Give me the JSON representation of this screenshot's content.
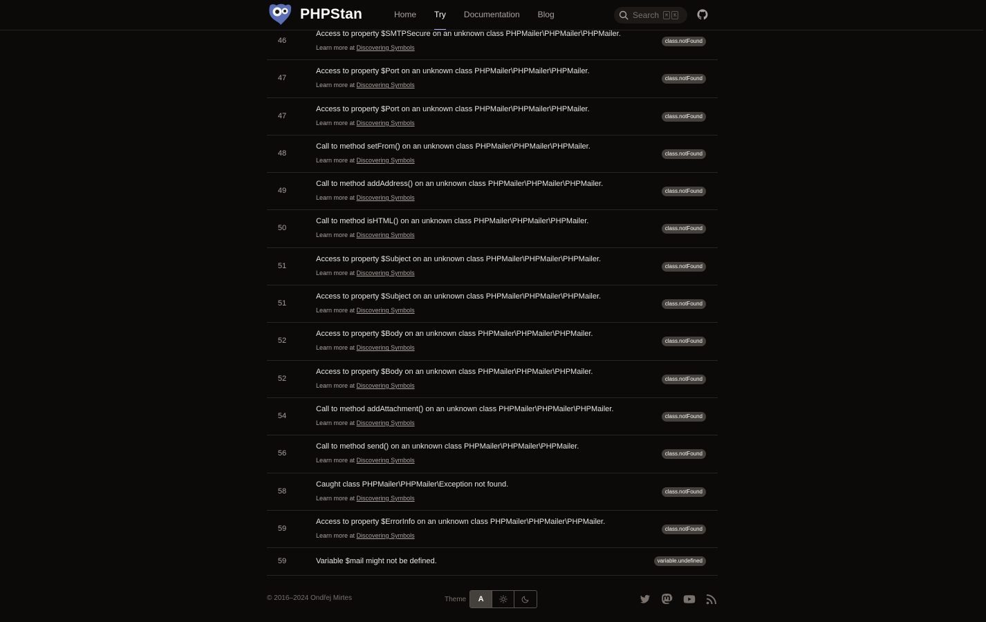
{
  "header": {
    "brand": "PHPStan",
    "nav": [
      {
        "label": "Home",
        "active": false
      },
      {
        "label": "Try",
        "active": true
      },
      {
        "label": "Documentation",
        "active": false
      },
      {
        "label": "Blog",
        "active": false
      }
    ],
    "search_label": "Search",
    "search_kbd": [
      "⌘",
      "K"
    ]
  },
  "errors": [
    {
      "line": "46",
      "message": "Access to property $SMTPSecure on an unknown class PHPMailer\\PHPMailer\\PHPMailer.",
      "learn_prefix": "Learn more at",
      "learn_link": "Discovering Symbols",
      "identifier": "class.notFound"
    },
    {
      "line": "47",
      "message": "Access to property $Port on an unknown class PHPMailer\\PHPMailer\\PHPMailer.",
      "learn_prefix": "Learn more at",
      "learn_link": "Discovering Symbols",
      "identifier": "class.notFound"
    },
    {
      "line": "47",
      "message": "Access to property $Port on an unknown class PHPMailer\\PHPMailer\\PHPMailer.",
      "learn_prefix": "Learn more at",
      "learn_link": "Discovering Symbols",
      "identifier": "class.notFound"
    },
    {
      "line": "48",
      "message": "Call to method setFrom() on an unknown class PHPMailer\\PHPMailer\\PHPMailer.",
      "learn_prefix": "Learn more at",
      "learn_link": "Discovering Symbols",
      "identifier": "class.notFound"
    },
    {
      "line": "49",
      "message": "Call to method addAddress() on an unknown class PHPMailer\\PHPMailer\\PHPMailer.",
      "learn_prefix": "Learn more at",
      "learn_link": "Discovering Symbols",
      "identifier": "class.notFound"
    },
    {
      "line": "50",
      "message": "Call to method isHTML() on an unknown class PHPMailer\\PHPMailer\\PHPMailer.",
      "learn_prefix": "Learn more at",
      "learn_link": "Discovering Symbols",
      "identifier": "class.notFound"
    },
    {
      "line": "51",
      "message": "Access to property $Subject on an unknown class PHPMailer\\PHPMailer\\PHPMailer.",
      "learn_prefix": "Learn more at",
      "learn_link": "Discovering Symbols",
      "identifier": "class.notFound"
    },
    {
      "line": "51",
      "message": "Access to property $Subject on an unknown class PHPMailer\\PHPMailer\\PHPMailer.",
      "learn_prefix": "Learn more at",
      "learn_link": "Discovering Symbols",
      "identifier": "class.notFound"
    },
    {
      "line": "52",
      "message": "Access to property $Body on an unknown class PHPMailer\\PHPMailer\\PHPMailer.",
      "learn_prefix": "Learn more at",
      "learn_link": "Discovering Symbols",
      "identifier": "class.notFound"
    },
    {
      "line": "52",
      "message": "Access to property $Body on an unknown class PHPMailer\\PHPMailer\\PHPMailer.",
      "learn_prefix": "Learn more at",
      "learn_link": "Discovering Symbols",
      "identifier": "class.notFound"
    },
    {
      "line": "54",
      "message": "Call to method addAttachment() on an unknown class PHPMailer\\PHPMailer\\PHPMailer.",
      "learn_prefix": "Learn more at",
      "learn_link": "Discovering Symbols",
      "identifier": "class.notFound"
    },
    {
      "line": "56",
      "message": "Call to method send() on an unknown class PHPMailer\\PHPMailer\\PHPMailer.",
      "learn_prefix": "Learn more at",
      "learn_link": "Discovering Symbols",
      "identifier": "class.notFound"
    },
    {
      "line": "58",
      "message": "Caught class PHPMailer\\PHPMailer\\Exception not found.",
      "learn_prefix": "Learn more at",
      "learn_link": "Discovering Symbols",
      "identifier": "class.notFound"
    },
    {
      "line": "59",
      "message": "Access to property $ErrorInfo on an unknown class PHPMailer\\PHPMailer\\PHPMailer.",
      "learn_prefix": "Learn more at",
      "learn_link": "Discovering Symbols",
      "identifier": "class.notFound"
    },
    {
      "line": "59",
      "message": "Variable $mail might not be defined.",
      "identifier": "variable.undefined"
    }
  ],
  "footer": {
    "copyright": "© 2016–2024 Ondřej Mirtes",
    "theme_label": "Theme",
    "theme_options": [
      {
        "label": "A",
        "icon": "auto-icon",
        "active": true
      },
      {
        "label": "",
        "icon": "sun-icon",
        "active": false
      },
      {
        "label": "",
        "icon": "moon-icon",
        "active": false
      }
    ],
    "social": [
      "twitter-icon",
      "mastodon-icon",
      "youtube-icon",
      "rss-icon"
    ]
  },
  "colors": {
    "background": "#0c0a09",
    "divider": "#292524",
    "badge": "#44403c",
    "accent": "#a5b4fc",
    "logo": "#5b6fb8"
  }
}
